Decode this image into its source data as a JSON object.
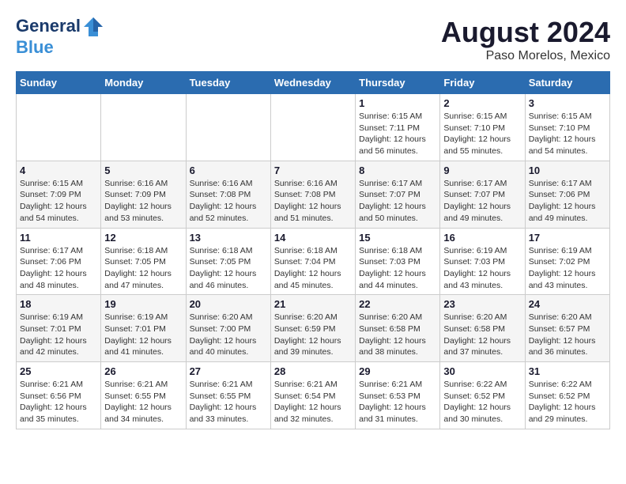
{
  "header": {
    "logo_line1": "General",
    "logo_line2": "Blue",
    "title": "August 2024",
    "subtitle": "Paso Morelos, Mexico"
  },
  "weekdays": [
    "Sunday",
    "Monday",
    "Tuesday",
    "Wednesday",
    "Thursday",
    "Friday",
    "Saturday"
  ],
  "rows": [
    [
      {
        "day": "",
        "sunrise": "",
        "sunset": "",
        "daylight": ""
      },
      {
        "day": "",
        "sunrise": "",
        "sunset": "",
        "daylight": ""
      },
      {
        "day": "",
        "sunrise": "",
        "sunset": "",
        "daylight": ""
      },
      {
        "day": "",
        "sunrise": "",
        "sunset": "",
        "daylight": ""
      },
      {
        "day": "1",
        "sunrise": "Sunrise: 6:15 AM",
        "sunset": "Sunset: 7:11 PM",
        "daylight": "Daylight: 12 hours and 56 minutes."
      },
      {
        "day": "2",
        "sunrise": "Sunrise: 6:15 AM",
        "sunset": "Sunset: 7:10 PM",
        "daylight": "Daylight: 12 hours and 55 minutes."
      },
      {
        "day": "3",
        "sunrise": "Sunrise: 6:15 AM",
        "sunset": "Sunset: 7:10 PM",
        "daylight": "Daylight: 12 hours and 54 minutes."
      }
    ],
    [
      {
        "day": "4",
        "sunrise": "Sunrise: 6:15 AM",
        "sunset": "Sunset: 7:09 PM",
        "daylight": "Daylight: 12 hours and 54 minutes."
      },
      {
        "day": "5",
        "sunrise": "Sunrise: 6:16 AM",
        "sunset": "Sunset: 7:09 PM",
        "daylight": "Daylight: 12 hours and 53 minutes."
      },
      {
        "day": "6",
        "sunrise": "Sunrise: 6:16 AM",
        "sunset": "Sunset: 7:08 PM",
        "daylight": "Daylight: 12 hours and 52 minutes."
      },
      {
        "day": "7",
        "sunrise": "Sunrise: 6:16 AM",
        "sunset": "Sunset: 7:08 PM",
        "daylight": "Daylight: 12 hours and 51 minutes."
      },
      {
        "day": "8",
        "sunrise": "Sunrise: 6:17 AM",
        "sunset": "Sunset: 7:07 PM",
        "daylight": "Daylight: 12 hours and 50 minutes."
      },
      {
        "day": "9",
        "sunrise": "Sunrise: 6:17 AM",
        "sunset": "Sunset: 7:07 PM",
        "daylight": "Daylight: 12 hours and 49 minutes."
      },
      {
        "day": "10",
        "sunrise": "Sunrise: 6:17 AM",
        "sunset": "Sunset: 7:06 PM",
        "daylight": "Daylight: 12 hours and 49 minutes."
      }
    ],
    [
      {
        "day": "11",
        "sunrise": "Sunrise: 6:17 AM",
        "sunset": "Sunset: 7:06 PM",
        "daylight": "Daylight: 12 hours and 48 minutes."
      },
      {
        "day": "12",
        "sunrise": "Sunrise: 6:18 AM",
        "sunset": "Sunset: 7:05 PM",
        "daylight": "Daylight: 12 hours and 47 minutes."
      },
      {
        "day": "13",
        "sunrise": "Sunrise: 6:18 AM",
        "sunset": "Sunset: 7:05 PM",
        "daylight": "Daylight: 12 hours and 46 minutes."
      },
      {
        "day": "14",
        "sunrise": "Sunrise: 6:18 AM",
        "sunset": "Sunset: 7:04 PM",
        "daylight": "Daylight: 12 hours and 45 minutes."
      },
      {
        "day": "15",
        "sunrise": "Sunrise: 6:18 AM",
        "sunset": "Sunset: 7:03 PM",
        "daylight": "Daylight: 12 hours and 44 minutes."
      },
      {
        "day": "16",
        "sunrise": "Sunrise: 6:19 AM",
        "sunset": "Sunset: 7:03 PM",
        "daylight": "Daylight: 12 hours and 43 minutes."
      },
      {
        "day": "17",
        "sunrise": "Sunrise: 6:19 AM",
        "sunset": "Sunset: 7:02 PM",
        "daylight": "Daylight: 12 hours and 43 minutes."
      }
    ],
    [
      {
        "day": "18",
        "sunrise": "Sunrise: 6:19 AM",
        "sunset": "Sunset: 7:01 PM",
        "daylight": "Daylight: 12 hours and 42 minutes."
      },
      {
        "day": "19",
        "sunrise": "Sunrise: 6:19 AM",
        "sunset": "Sunset: 7:01 PM",
        "daylight": "Daylight: 12 hours and 41 minutes."
      },
      {
        "day": "20",
        "sunrise": "Sunrise: 6:20 AM",
        "sunset": "Sunset: 7:00 PM",
        "daylight": "Daylight: 12 hours and 40 minutes."
      },
      {
        "day": "21",
        "sunrise": "Sunrise: 6:20 AM",
        "sunset": "Sunset: 6:59 PM",
        "daylight": "Daylight: 12 hours and 39 minutes."
      },
      {
        "day": "22",
        "sunrise": "Sunrise: 6:20 AM",
        "sunset": "Sunset: 6:58 PM",
        "daylight": "Daylight: 12 hours and 38 minutes."
      },
      {
        "day": "23",
        "sunrise": "Sunrise: 6:20 AM",
        "sunset": "Sunset: 6:58 PM",
        "daylight": "Daylight: 12 hours and 37 minutes."
      },
      {
        "day": "24",
        "sunrise": "Sunrise: 6:20 AM",
        "sunset": "Sunset: 6:57 PM",
        "daylight": "Daylight: 12 hours and 36 minutes."
      }
    ],
    [
      {
        "day": "25",
        "sunrise": "Sunrise: 6:21 AM",
        "sunset": "Sunset: 6:56 PM",
        "daylight": "Daylight: 12 hours and 35 minutes."
      },
      {
        "day": "26",
        "sunrise": "Sunrise: 6:21 AM",
        "sunset": "Sunset: 6:55 PM",
        "daylight": "Daylight: 12 hours and 34 minutes."
      },
      {
        "day": "27",
        "sunrise": "Sunrise: 6:21 AM",
        "sunset": "Sunset: 6:55 PM",
        "daylight": "Daylight: 12 hours and 33 minutes."
      },
      {
        "day": "28",
        "sunrise": "Sunrise: 6:21 AM",
        "sunset": "Sunset: 6:54 PM",
        "daylight": "Daylight: 12 hours and 32 minutes."
      },
      {
        "day": "29",
        "sunrise": "Sunrise: 6:21 AM",
        "sunset": "Sunset: 6:53 PM",
        "daylight": "Daylight: 12 hours and 31 minutes."
      },
      {
        "day": "30",
        "sunrise": "Sunrise: 6:22 AM",
        "sunset": "Sunset: 6:52 PM",
        "daylight": "Daylight: 12 hours and 30 minutes."
      },
      {
        "day": "31",
        "sunrise": "Sunrise: 6:22 AM",
        "sunset": "Sunset: 6:52 PM",
        "daylight": "Daylight: 12 hours and 29 minutes."
      }
    ]
  ]
}
